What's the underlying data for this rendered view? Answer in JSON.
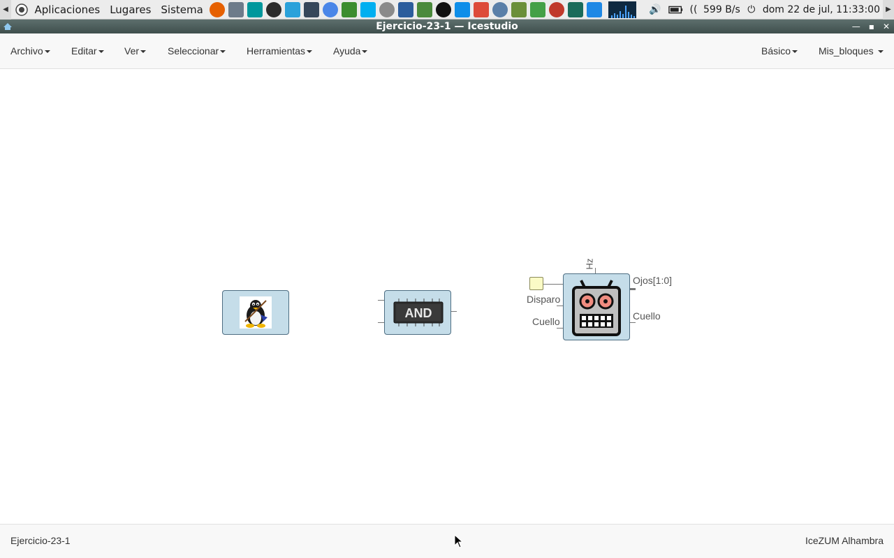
{
  "system_panel": {
    "menus": [
      "Aplicaciones",
      "Lugares",
      "Sistema"
    ],
    "launchers": [
      "firefox-icon",
      "file-manager-icon",
      "arduino-icon",
      "terminal-icon",
      "telegram-icon",
      "monitor-icon",
      "chromium-icon",
      "editor-icon",
      "skype-icon",
      "calculator-icon",
      "virtualbox-icon",
      "spreadsheet-icon",
      "media-player-icon",
      "teamviewer-icon",
      "chrome-icon",
      "maps-icon",
      "game-icon",
      "network-icon",
      "fritzing-icon",
      "gitkraken-icon",
      "codeblocks-icon"
    ],
    "net_speed": "599 B/s",
    "clock": "dom 22 de jul, 11:33:00"
  },
  "window": {
    "title": "Ejercicio-23-1 — Icestudio"
  },
  "menubar": {
    "left": [
      "Archivo",
      "Editar",
      "Ver",
      "Seleccionar",
      "Herramientas",
      "Ayuda"
    ],
    "right": [
      "Básico",
      "Mis_bloques"
    ]
  },
  "canvas": {
    "blocks": [
      {
        "name": "linux-tux-block",
        "icon": "tux-penguin-icon"
      },
      {
        "name": "and-gate-block",
        "icon": "and-chip-icon",
        "chip_text": "AND"
      },
      {
        "name": "robot-block",
        "icon": "robot-face-icon",
        "top_param": "Hz",
        "input_labels": [
          "Disparo",
          "Cuello"
        ],
        "output_labels": [
          "Ojos[1:0]",
          "Cuello"
        ]
      }
    ]
  },
  "statusbar": {
    "project": "Ejercicio-23-1",
    "board": "IceZUM Alhambra"
  }
}
